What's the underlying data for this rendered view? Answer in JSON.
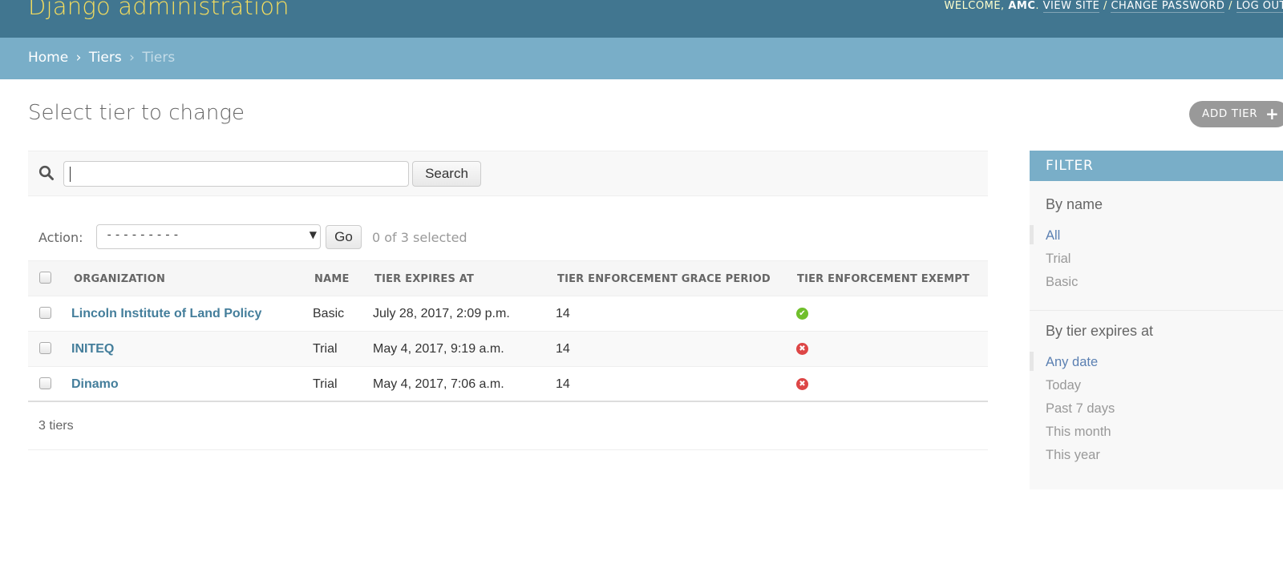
{
  "header": {
    "branding": "Django administration",
    "welcome": "Welcome,",
    "username": "AMC",
    "view_site": "View site",
    "change_password": "Change password",
    "log_out": "Log out",
    "separator": "/"
  },
  "breadcrumbs": {
    "home": "Home",
    "app": "Tiers",
    "current": "Tiers",
    "separator": "›"
  },
  "page": {
    "title": "Select tier to change",
    "add_button": "Add tier",
    "add_icon": "plus-icon"
  },
  "search": {
    "value": "",
    "button": "Search",
    "icon": "search-icon"
  },
  "actions": {
    "label": "Action:",
    "selected_option": "---------",
    "go": "Go",
    "selection_count": "0 of 3 selected"
  },
  "table": {
    "columns": [
      "Organization",
      "Name",
      "Tier expires at",
      "Tier enforcement grace period",
      "Tier enforcement exempt"
    ],
    "rows": [
      {
        "organization": "Lincoln Institute of Land Policy",
        "name": "Basic",
        "expires": "July 28, 2017, 2:09 p.m.",
        "grace_period": "14",
        "exempt": true,
        "exempt_icon": "✔"
      },
      {
        "organization": "INITEQ",
        "name": "Trial",
        "expires": "May 4, 2017, 9:19 a.m.",
        "grace_period": "14",
        "exempt": false,
        "exempt_icon": "✖"
      },
      {
        "organization": "Dinamo",
        "name": "Trial",
        "expires": "May 4, 2017, 7:06 a.m.",
        "grace_period": "14",
        "exempt": false,
        "exempt_icon": "✖"
      }
    ]
  },
  "paginator": {
    "text": "3 tiers"
  },
  "filter": {
    "heading": "Filter",
    "sections": [
      {
        "title": "By name",
        "items": [
          "All",
          "Trial",
          "Basic"
        ],
        "selected": "All"
      },
      {
        "title": "By tier expires at",
        "items": [
          "Any date",
          "Today",
          "Past 7 days",
          "This month",
          "This year"
        ],
        "selected": "Any date"
      }
    ]
  },
  "colors": {
    "header_bg": "#417690",
    "branding": "#f5dd5d",
    "breadcrumbs_bg": "#79aec8",
    "link": "#447e9b",
    "yes": "#70bf2b",
    "no": "#dd4646"
  }
}
